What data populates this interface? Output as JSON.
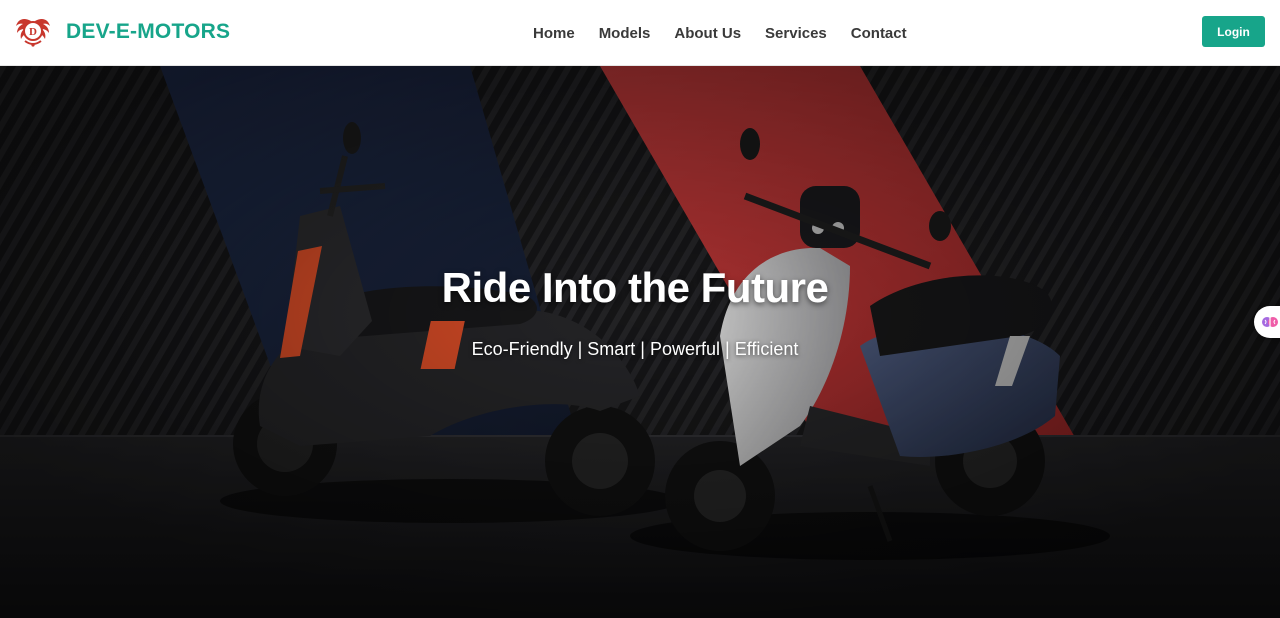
{
  "brand": {
    "name": "DEV-E-MOTORS",
    "logo_icon": "winged-d-emblem-icon",
    "logo_letter": "D"
  },
  "nav": {
    "links": [
      {
        "label": "Home"
      },
      {
        "label": "Models"
      },
      {
        "label": "About Us"
      },
      {
        "label": "Services"
      },
      {
        "label": "Contact"
      }
    ],
    "login_label": "Login"
  },
  "hero": {
    "title": "Ride Into the Future",
    "subtitle": "Eco-Friendly | Smart | Powerful | Efficient",
    "image": "two-electric-scooters-photo"
  },
  "widget": {
    "icon": "brain-icon"
  },
  "colors": {
    "accent": "#17a58a",
    "nav_text": "#3a3a3a",
    "logo_red": "#c8372d",
    "hero_red": "#d63a3a",
    "hero_navy": "#1f2d4d"
  }
}
